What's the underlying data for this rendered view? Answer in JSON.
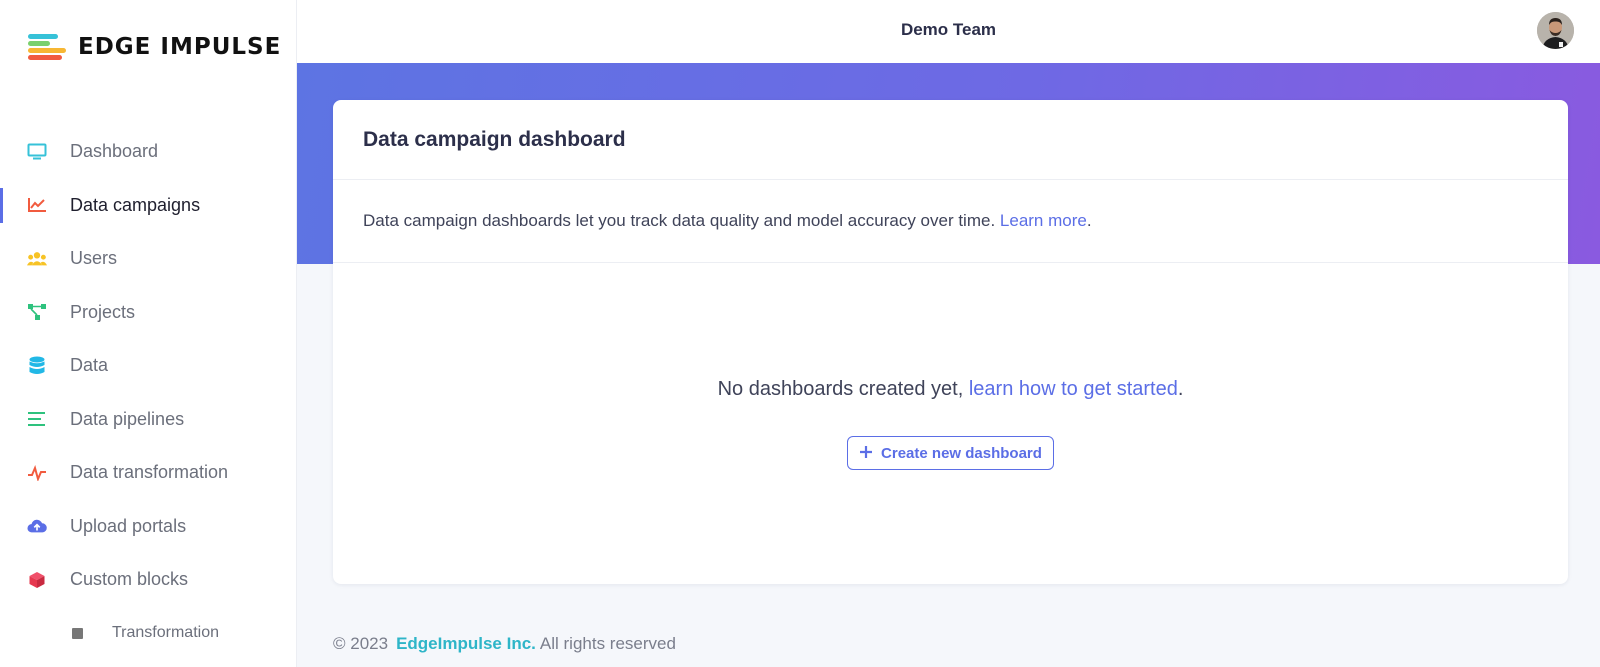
{
  "brand": {
    "name": "EDGE IMPULSE",
    "colors": [
      "#36c2d8",
      "#7ad06d",
      "#f7b733",
      "#f15b3f"
    ]
  },
  "topbar": {
    "team_name": "Demo Team"
  },
  "sidebar": {
    "items": [
      {
        "label": "Dashboard",
        "icon": "monitor-icon",
        "color": "#36c2d8"
      },
      {
        "label": "Data campaigns",
        "icon": "chart-line-icon",
        "color": "#f15b3f",
        "active": true
      },
      {
        "label": "Users",
        "icon": "users-icon",
        "color": "#f7c325"
      },
      {
        "label": "Projects",
        "icon": "project-tree-icon",
        "color": "#2ec27e"
      },
      {
        "label": "Data",
        "icon": "database-icon",
        "color": "#22b8e6"
      },
      {
        "label": "Data pipelines",
        "icon": "list-icon",
        "color": "#2ec27e"
      },
      {
        "label": "Data transformation",
        "icon": "activity-icon",
        "color": "#f15b3f"
      },
      {
        "label": "Upload portals",
        "icon": "cloud-upload-icon",
        "color": "#5b6ee6"
      },
      {
        "label": "Custom blocks",
        "icon": "cube-icon",
        "color": "#e6384f"
      }
    ],
    "sub_items": [
      {
        "label": "Transformation"
      }
    ]
  },
  "main": {
    "card_title": "Data campaign dashboard",
    "description": "Data campaign dashboards let you track data quality and model accuracy over time.",
    "description_link": "Learn more",
    "description_end": ".",
    "empty_text": "No dashboards created yet, ",
    "empty_link": "learn how to get started",
    "empty_end": ".",
    "create_button": "Create new dashboard",
    "create_button_icon": "plus-icon"
  },
  "footer": {
    "copyright": "© 2023",
    "company": "EdgeImpulse Inc.",
    "rights": "All rights reserved"
  }
}
